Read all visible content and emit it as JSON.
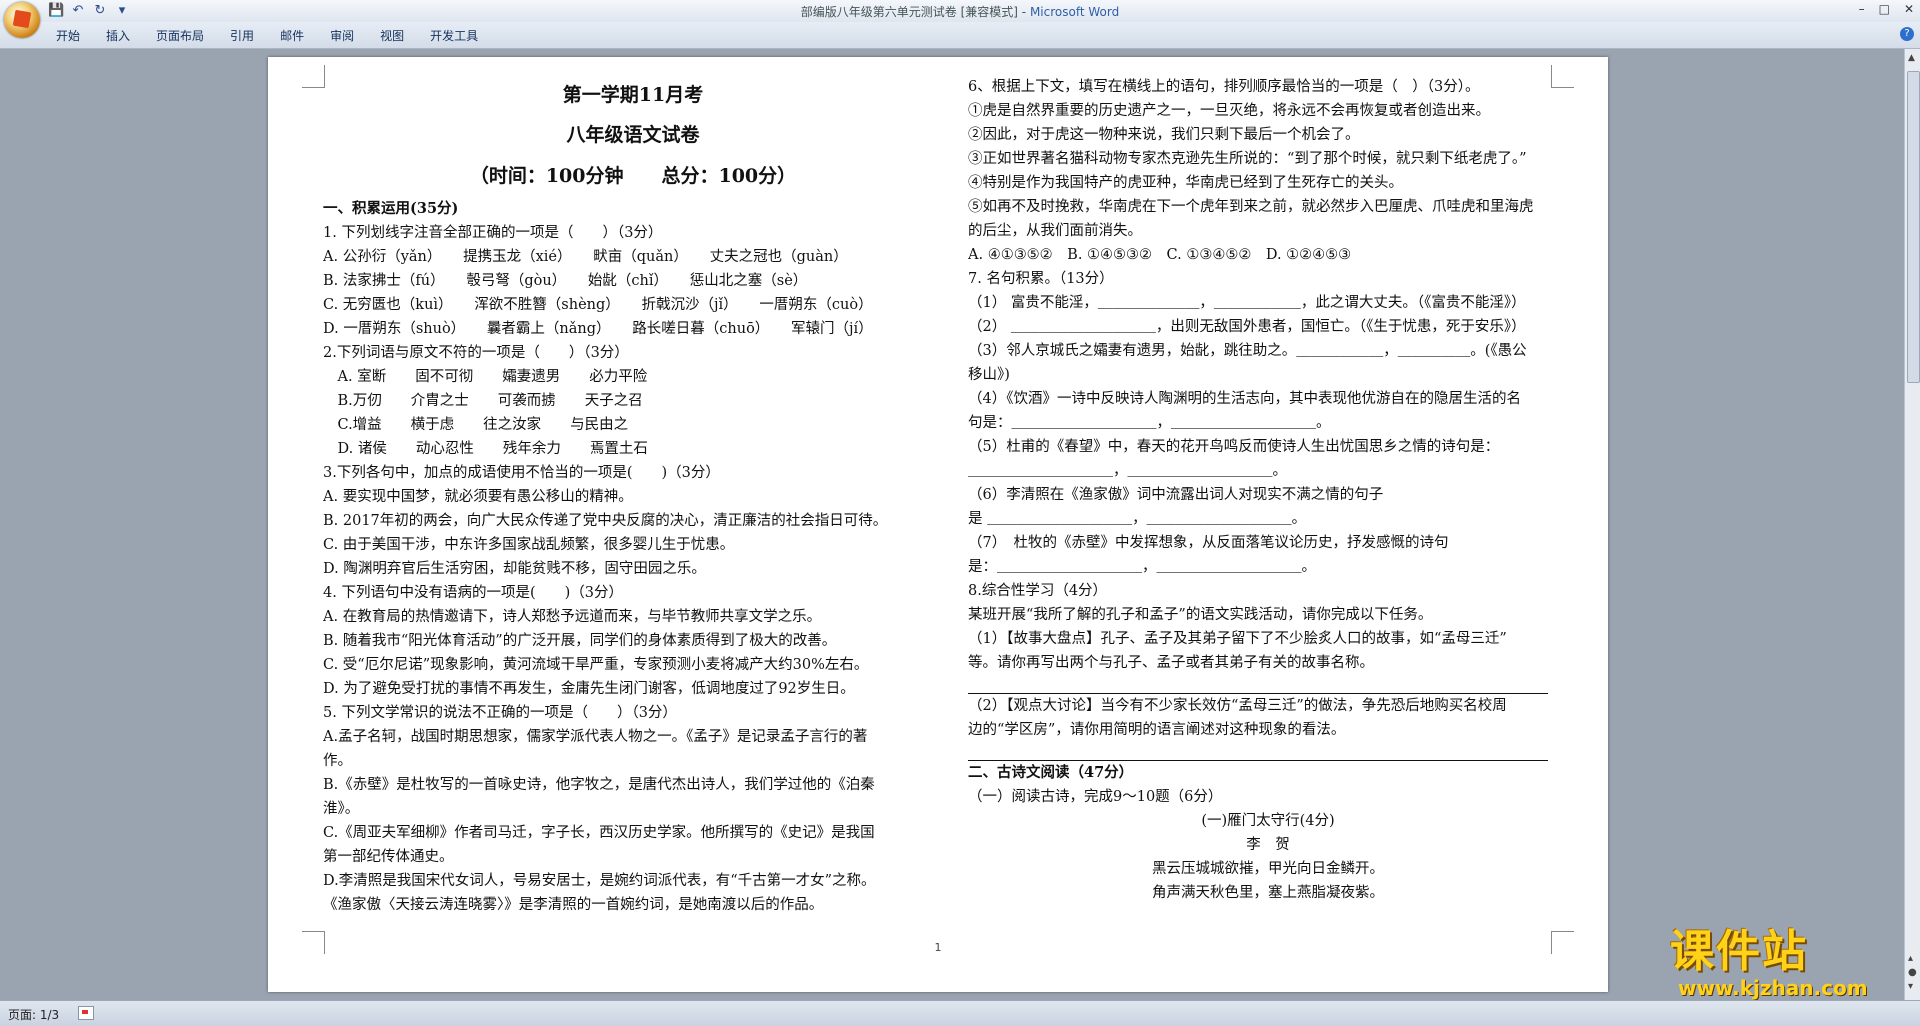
{
  "window": {
    "doc_name": "部编版八年级第六单元测试卷 [兼容模式]",
    "app_name": "Microsoft Word"
  },
  "qat": {
    "save_icon": "save-icon",
    "undo_icon": "undo-icon",
    "redo_icon": "redo-icon",
    "customize_icon": "customize-icon"
  },
  "ribbon": {
    "tabs": [
      "开始",
      "插入",
      "页面布局",
      "引用",
      "邮件",
      "审阅",
      "视图",
      "开发工具"
    ]
  },
  "status": {
    "page": "页面: 1/3"
  },
  "page_number": "1",
  "watermark": {
    "text": "课件站",
    "url": "www.kjzhan.com"
  },
  "doc": {
    "left": [
      "第一学期11月考",
      "八年级语文试卷",
      "（时间：100分钟　　总分：100分）",
      "一、积累运用(35分)",
      "1. 下列划线字注音全部正确的一项是（　　）（3分）",
      "A. 公孙衍（yǎn）　　提携玉龙（xié）　　畎亩（quǎn）　　丈夫之冠也（guàn）",
      "B. 法家拂士（fú）　　彀弓弩（gòu）　　始龀（chǐ）　　惩山北之塞（sè）",
      "C. 无穷匮也（kuì）　　浑欲不胜簪（shèng）　　折戟沉沙（jǐ）　　一厝朔东（cuò）",
      "D. 一厝朔东（shuò）　　曩者霸上（nǎng）　　路长嗟日暮（chuō）　　军辕门（jí）",
      "2.下列词语与原文不符的一项是（　　）（3分）",
      "　A. 室断　　固不可彻　　孀妻遗男　　必力平险",
      "　B.万仞　　介胄之士　　可袭而掳　　天子之召",
      "　C.增益　　横于虑　　往之汝家　　与民由之",
      "　D. 诸侯　　动心忍性　　残年余力　　焉置土石",
      "3.下列各句中，加点的成语使用不恰当的一项是(　　)（3分）",
      "A. 要实现中国梦，就必须要有愚公移山的精神。",
      "B. 2017年初的两会，向广大民众传递了党中央反腐的决心，清正廉洁的社会指日可待。",
      "C. 由于美国干涉，中东许多国家战乱频繁，很多婴儿生于忧患。",
      "D. 陶渊明弃官后生活穷困，却能贫贱不移，固守田园之乐。",
      "4. 下列语句中没有语病的一项是(　　)（3分）",
      "A. 在教育局的热情邀请下，诗人郑愁予远道而来，与毕节教师共享文学之乐。",
      "B. 随着我市“阳光体育活动”的广泛开展，同学们的身体素质得到了极大的改善。",
      "C. 受“厄尔尼诺”现象影响，黄河流域干旱严重，专家预测小麦将减产大约30%左右。",
      "D. 为了避免受打扰的事情不再发生，金庸先生闭门谢客，低调地度过了92岁生日。",
      "5. 下列文学常识的说法不正确的一项是（　　）（3分）",
      "A.孟子名轲，战国时期思想家，儒家学派代表人物之一。《孟子》是记录孟子言行的著",
      "作。",
      "B.《赤壁》是杜牧写的一首咏史诗，他字牧之，是唐代杰出诗人，我们学过他的《泊秦",
      "淮》。",
      "C.《周亚夫军细柳》作者司马迁，字子长，西汉历史学家。他所撰写的《史记》是我国",
      "第一部纪传体通史。",
      "D.李清照是我国宋代女词人，号易安居士，是婉约词派代表，有“千古第一才女”之称。",
      "《渔家傲〈天接云涛连晓雾〉》是李清照的一首婉约词，是她南渡以后的作品。"
    ],
    "right": [
      "6、根据上下文，填写在横线上的语句，排列顺序最恰当的一项是（　）（3分）。",
      "①虎是自然界重要的历史遗产之一，一旦灭绝，将永远不会再恢复或者创造出来。",
      "②因此，对于虎这一物种来说，我们只剩下最后一个机会了。",
      "③正如世界著名猫科动物专家杰克逊先生所说的：“到了那个时候，就只剩下纸老虎了。”",
      "④特别是作为我国特产的虎亚种，华南虎已经到了生死存亡的关头。",
      "⑤如再不及时挽救，华南虎在下一个虎年到来之前，就必然步入巴厘虎、爪哇虎和里海虎",
      "的后尘，从我们面前消失。",
      " A. ④①③⑤②　B. ①④⑤③②　C. ①③④⑤②　D. ①②④⑤③",
      "7. 名句积累。（13分）",
      "（1） 富贵不能淫，＿＿＿＿＿＿＿，＿＿＿＿＿＿，此之谓大丈夫。（《富贵不能淫》）",
      "（2） ＿＿＿＿＿＿＿＿＿＿，出则无敌国外患者，国恒亡。（《生于忧患，死于安乐》）",
      "（3）邻人京城氏之孀妻有遗男，始龀，跳往助之。＿＿＿＿＿＿，＿＿＿＿＿。(《愚公",
      "移山》)",
      "（4）《饮酒》一诗中反映诗人陶渊明的生活志向，其中表现他优游自在的隐居生活的名",
      "句是：＿＿＿＿＿＿＿＿＿＿，＿＿＿＿＿＿＿＿＿＿。",
      "（5）杜甫的《春望》中，春天的花开鸟鸣反而使诗人生出忧国思乡之情的诗句是：",
      "＿＿＿＿＿＿＿＿＿＿，＿＿＿＿＿＿＿＿＿＿。",
      "（6）李清照在《渔家傲》词中流露出词人对现实不满之情的句子",
      "是 ＿＿＿＿＿＿＿＿＿＿，＿＿＿＿＿＿＿＿＿＿。",
      "（7）　杜牧的《赤壁》中发挥想象，从反面落笔议论历史，抒发感慨的诗句",
      "是：＿＿＿＿＿＿＿＿＿＿，＿＿＿＿＿＿＿＿＿＿。",
      "8.综合性学习（4分）",
      "某班开展“我所了解的孔子和孟子”的语文实践活动，请你完成以下任务。",
      "（1）【故事大盘点】孔子、孟子及其弟子留下了不少脍炙人口的故事，如“孟母三迁”",
      "等。请你再写出两个与孔子、孟子或者其弟子有关的故事名称。",
      "",
      "（2）【观点大讨论】当今有不少家长效仿“孟母三迁”的做法，争先恐后地购买名校周",
      "边的“学区房”，请你用简明的语言阐述对这种现象的看法。",
      "",
      "二、古诗文阅读（47分）",
      "（一）阅读古诗，完成9～10题（6分）",
      "(一)雁门太守行(4分)",
      "李　贺",
      "黑云压城城欲摧，甲光向日金鳞开。",
      "角声满天秋色里，塞上燕脂凝夜紫。"
    ]
  }
}
